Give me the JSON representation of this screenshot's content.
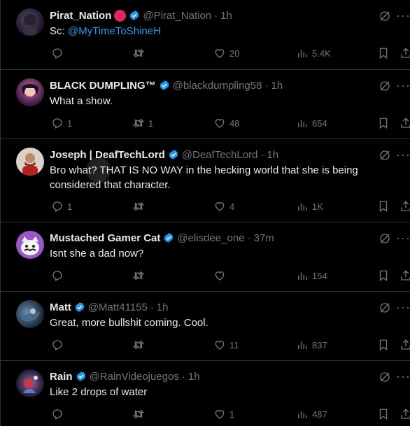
{
  "colors": {
    "background": "#000000",
    "text": "#e7e9ea",
    "muted": "#71767b",
    "link": "#1d9bf0",
    "verified": "#1d9bf0",
    "divider": "#2f3336"
  },
  "icons": [
    "reply-icon",
    "retweet-icon",
    "like-icon",
    "views-icon",
    "bookmark-icon",
    "share-icon",
    "verified-badge-icon",
    "grok-icon",
    "more-icon"
  ],
  "tweets": [
    {
      "name": "Pirat_Nation",
      "handle": "@Pirat_Nation",
      "time": "1h",
      "text_prefix": "Sc: ",
      "mention": "@MyTimeToShineH",
      "text": "",
      "replies": "",
      "retweets": "",
      "likes": "20",
      "views": "5.4K"
    },
    {
      "name": "BLACK DUMPLING™",
      "handle": "@blackdumpling58",
      "time": "1h",
      "text_prefix": "",
      "mention": "",
      "text": "What a show.",
      "replies": "1",
      "retweets": "1",
      "likes": "48",
      "views": "654"
    },
    {
      "name": "Joseph | DeafTechLord",
      "handle": "@DeafTechLord",
      "time": "1h",
      "text_prefix": "",
      "mention": "",
      "text": "Bro what? THAT IS NO WAY in the hecking world that she is being considered that character.",
      "replies": "1",
      "retweets": "",
      "likes": "4",
      "views": "1K"
    },
    {
      "name": "Mustached Gamer Cat",
      "handle": "@elisdee_one",
      "time": "37m",
      "text_prefix": "",
      "mention": "",
      "text": "Isnt she a dad now?",
      "replies": "",
      "retweets": "",
      "likes": "",
      "views": "154"
    },
    {
      "name": "Matt",
      "handle": "@Matt41155",
      "time": "1h",
      "text_prefix": "",
      "mention": "",
      "text": "Great, more bullshit coming. Cool.",
      "replies": "",
      "retweets": "",
      "likes": "11",
      "views": "837"
    },
    {
      "name": "Rain",
      "handle": "@RainVideojuegos",
      "time": "1h",
      "text_prefix": "",
      "mention": "",
      "text": "Like 2 drops of water",
      "replies": "",
      "retweets": "",
      "likes": "1",
      "views": "487"
    }
  ]
}
